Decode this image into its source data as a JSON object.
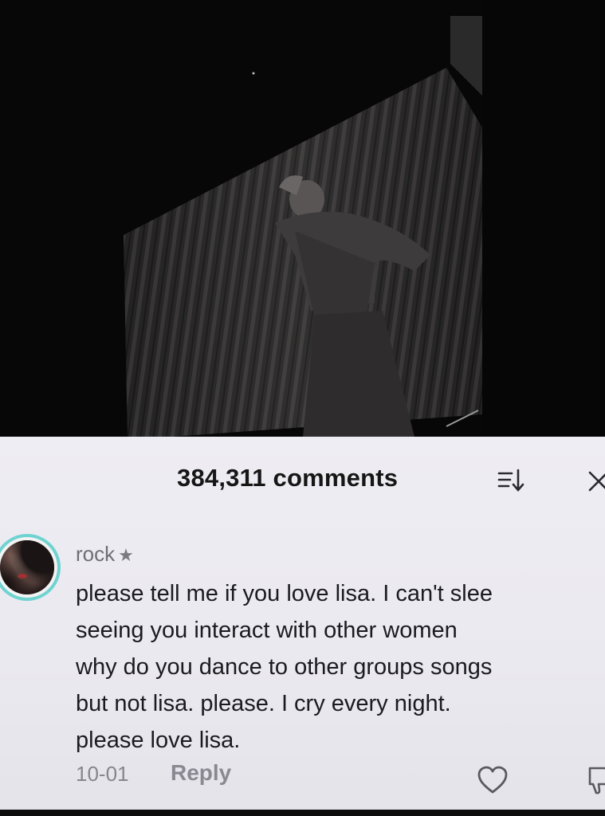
{
  "video": {
    "description_icon": "dancer-video-frame"
  },
  "comments_header": {
    "count_label": "384,311 comments",
    "sort_icon": "sort-icon",
    "close_icon": "close-icon"
  },
  "comment": {
    "username": "rock",
    "badge": "★",
    "text_lines": [
      "please tell me if you love lisa. I can't slee",
      "seeing you interact with other women",
      "why do you dance to other groups songs",
      "but not lisa. please. I cry every night.",
      "please love lisa."
    ],
    "date": "10-01",
    "reply_label": "Reply",
    "like_icon": "heart-icon",
    "dislike_icon": "dislike-icon"
  },
  "colors": {
    "sheet_bg": "#eeedf3",
    "avatar_ring": "#6fd3d1",
    "text_primary": "#1b1b1f",
    "text_secondary": "#86858d"
  }
}
